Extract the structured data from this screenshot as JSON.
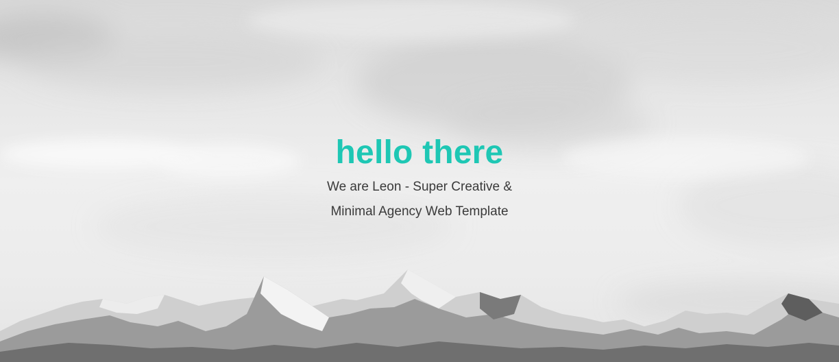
{
  "hero": {
    "title": "hello there",
    "subtitle_line1": "We are Leon - Super Creative &",
    "subtitle_line2": "Minimal Agency Web Template"
  },
  "colors": {
    "accent": "#1ec7b4",
    "text": "#3a3a3a",
    "sky": "#e8e8e8"
  },
  "background": {
    "image": "snowy-mountains-cloudy-sky-icon"
  }
}
